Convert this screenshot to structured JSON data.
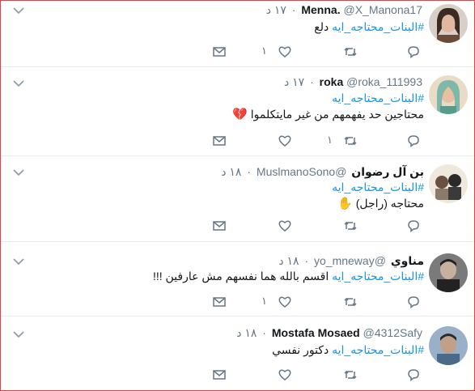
{
  "tweets": [
    {
      "name": "Menna.",
      "handle": "@X_Manona17",
      "time": "١٧ د",
      "hashtag": "#البنات_محتاجه_ايه",
      "text_after": "دلع",
      "text_line2": "",
      "likes": "١",
      "retweets": "",
      "avatar_color": "#6b4a3a"
    },
    {
      "name": "roka",
      "handle": "@roka_111993",
      "time": "١٧ د",
      "hashtag": "#البنات_محتاجه_ايه",
      "text_after": "",
      "text_line2": "محتاجين حد يفهمهم من غير مايتكلموا",
      "emoji": "💔",
      "likes": "",
      "retweets": "١",
      "avatar_color": "#c9b79c"
    },
    {
      "name": "بن آل رضوان",
      "handle": "@MuslmanoSono",
      "time": "١٨ د",
      "hashtag": "#البنات_محتاجه_ايه",
      "text_after": "",
      "text_line2": "محتاجه (راجل)",
      "emoji": "✋",
      "likes": "",
      "retweets": "",
      "avatar_color": "#8a7a6a"
    },
    {
      "name": "مناوي",
      "handle": "@yo_mneway",
      "time": "١٨ د",
      "hashtag": "#البنات_محتاجه_ايه",
      "text_after": "اقسم بالله هما نفسهم مش عارفين !!!",
      "text_line2": "",
      "likes": "١",
      "retweets": "",
      "avatar_color": "#3a3a3a"
    },
    {
      "name": "Mostafa Mosaed",
      "handle": "@4312Safy",
      "time": "١٨ د",
      "hashtag": "#البنات_محتاجه_ايه",
      "text_after": "دكتور نفسي",
      "text_line2": "",
      "likes": "",
      "retweets": "",
      "avatar_color": "#4a6a8a"
    }
  ],
  "icons": {
    "reply": "reply-icon",
    "retweet": "retweet-icon",
    "like": "heart-icon",
    "dm": "envelope-icon",
    "more": "chevron-down-icon"
  },
  "colors": {
    "hashtag": "#1b95e0",
    "meta": "#657786",
    "border": "#e04343"
  }
}
